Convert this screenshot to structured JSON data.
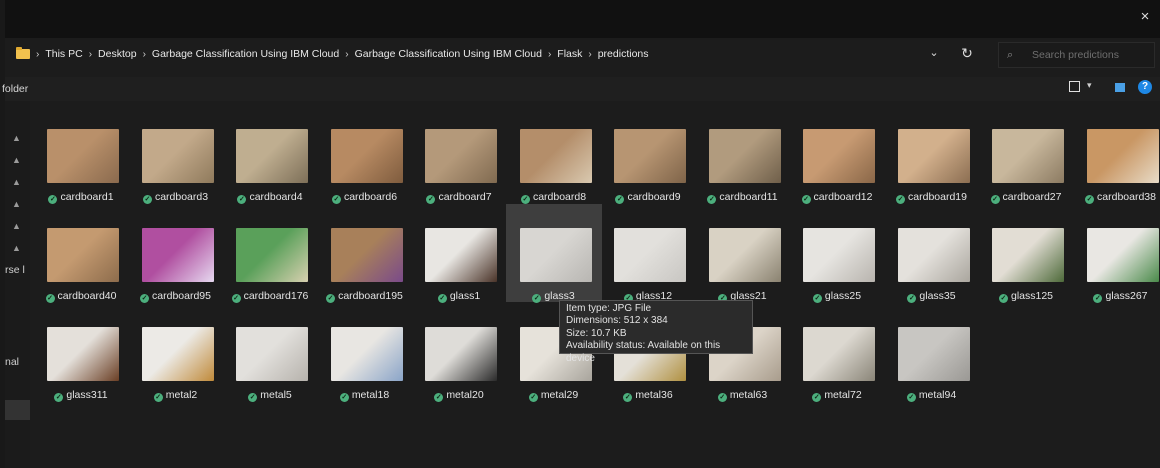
{
  "window": {
    "close_glyph": "×"
  },
  "address": {
    "crumbs": [
      "This PC",
      "Desktop",
      "Garbage Classification Using IBM Cloud",
      "Garbage Classification Using IBM Cloud",
      "Flask",
      "predictions"
    ],
    "separator": "›",
    "dropdown_glyph": "⌄",
    "refresh_glyph": "↻"
  },
  "search": {
    "placeholder": "Search predictions",
    "icon": "search-icon",
    "icon_glyph": "⌕"
  },
  "commandbar": {
    "label": "folder",
    "view_chevron": "▾",
    "help_glyph": "?"
  },
  "navpane": {
    "pin_glyph": "📌",
    "items": [
      "rse l",
      "nal"
    ]
  },
  "files": [
    {
      "name": "cardboard1",
      "colors": [
        "#b9906a",
        "#8a6a4e"
      ]
    },
    {
      "name": "cardboard3",
      "colors": [
        "#c2a98a",
        "#8f7a5c"
      ]
    },
    {
      "name": "cardboard4",
      "colors": [
        "#bfae90",
        "#7d6f58"
      ]
    },
    {
      "name": "cardboard6",
      "colors": [
        "#b78a62",
        "#7f5c3e"
      ]
    },
    {
      "name": "cardboard7",
      "colors": [
        "#b4997a",
        "#806a50"
      ]
    },
    {
      "name": "cardboard8",
      "colors": [
        "#b48e6a",
        "#d9c9b0"
      ]
    },
    {
      "name": "cardboard9",
      "colors": [
        "#b79572",
        "#7f6449"
      ]
    },
    {
      "name": "cardboard11",
      "colors": [
        "#b19b7e",
        "#6f5f4a"
      ]
    },
    {
      "name": "cardboard12",
      "colors": [
        "#c79a72",
        "#8a6748"
      ]
    },
    {
      "name": "cardboard19",
      "colors": [
        "#d2b08c",
        "#8c6e52"
      ]
    },
    {
      "name": "cardboard27",
      "colors": [
        "#c8b79c",
        "#8c7b62"
      ]
    },
    {
      "name": "cardboard38",
      "colors": [
        "#c99764",
        "#e8dcc8"
      ]
    },
    {
      "name": "cardboard40",
      "colors": [
        "#c49a70",
        "#8d6c4c"
      ]
    },
    {
      "name": "cardboard95",
      "colors": [
        "#b04fa0",
        "#e6d9f0"
      ]
    },
    {
      "name": "cardboard176",
      "colors": [
        "#5aa05a",
        "#d8d0b0"
      ]
    },
    {
      "name": "cardboard195",
      "colors": [
        "#a8805a",
        "#7a4a8a"
      ]
    },
    {
      "name": "glass1",
      "colors": [
        "#e8e6e2",
        "#4a3328"
      ]
    },
    {
      "name": "glass3",
      "colors": [
        "#d8d6d2",
        "#b8b6b2"
      ]
    },
    {
      "name": "glass12",
      "colors": [
        "#e2e0dc",
        "#c8c6c2"
      ]
    },
    {
      "name": "glass21",
      "colors": [
        "#d9d2c4",
        "#8a8270"
      ]
    },
    {
      "name": "glass25",
      "colors": [
        "#e6e4e0",
        "#b8b4ae"
      ]
    },
    {
      "name": "glass35",
      "colors": [
        "#e4e1dc",
        "#aaa69e"
      ]
    },
    {
      "name": "glass125",
      "colors": [
        "#e2ddd4",
        "#4e6a3a"
      ]
    },
    {
      "name": "glass267",
      "colors": [
        "#e9e7e3",
        "#4a8a4a"
      ]
    },
    {
      "name": "glass311",
      "colors": [
        "#e4e0da",
        "#6a3e24"
      ]
    },
    {
      "name": "metal2",
      "colors": [
        "#eceae6",
        "#c08a3a"
      ]
    },
    {
      "name": "metal5",
      "colors": [
        "#e2e0dc",
        "#b6b2ac"
      ]
    },
    {
      "name": "metal18",
      "colors": [
        "#e8e6e2",
        "#8aa4c8"
      ]
    },
    {
      "name": "metal20",
      "colors": [
        "#dedcd8",
        "#2a2a2a"
      ]
    },
    {
      "name": "metal29",
      "colors": [
        "#e6e2da",
        "#a8a49c"
      ]
    },
    {
      "name": "metal36",
      "colors": [
        "#e4e0d8",
        "#b09040"
      ]
    },
    {
      "name": "metal63",
      "colors": [
        "#dcd4c8",
        "#a89c8c"
      ]
    },
    {
      "name": "metal72",
      "colors": [
        "#dcd8d0",
        "#8a8578"
      ]
    },
    {
      "name": "metal94",
      "colors": [
        "#c8c6c2",
        "#9a9894"
      ]
    }
  ],
  "selected_file": "glass3",
  "tooltip": {
    "item_type": "Item type: JPG File",
    "dimensions": "Dimensions: 512 x 384",
    "size": "Size: 10.7 KB",
    "availability": "Availability status: Available on this device"
  },
  "check_glyph": "✓"
}
